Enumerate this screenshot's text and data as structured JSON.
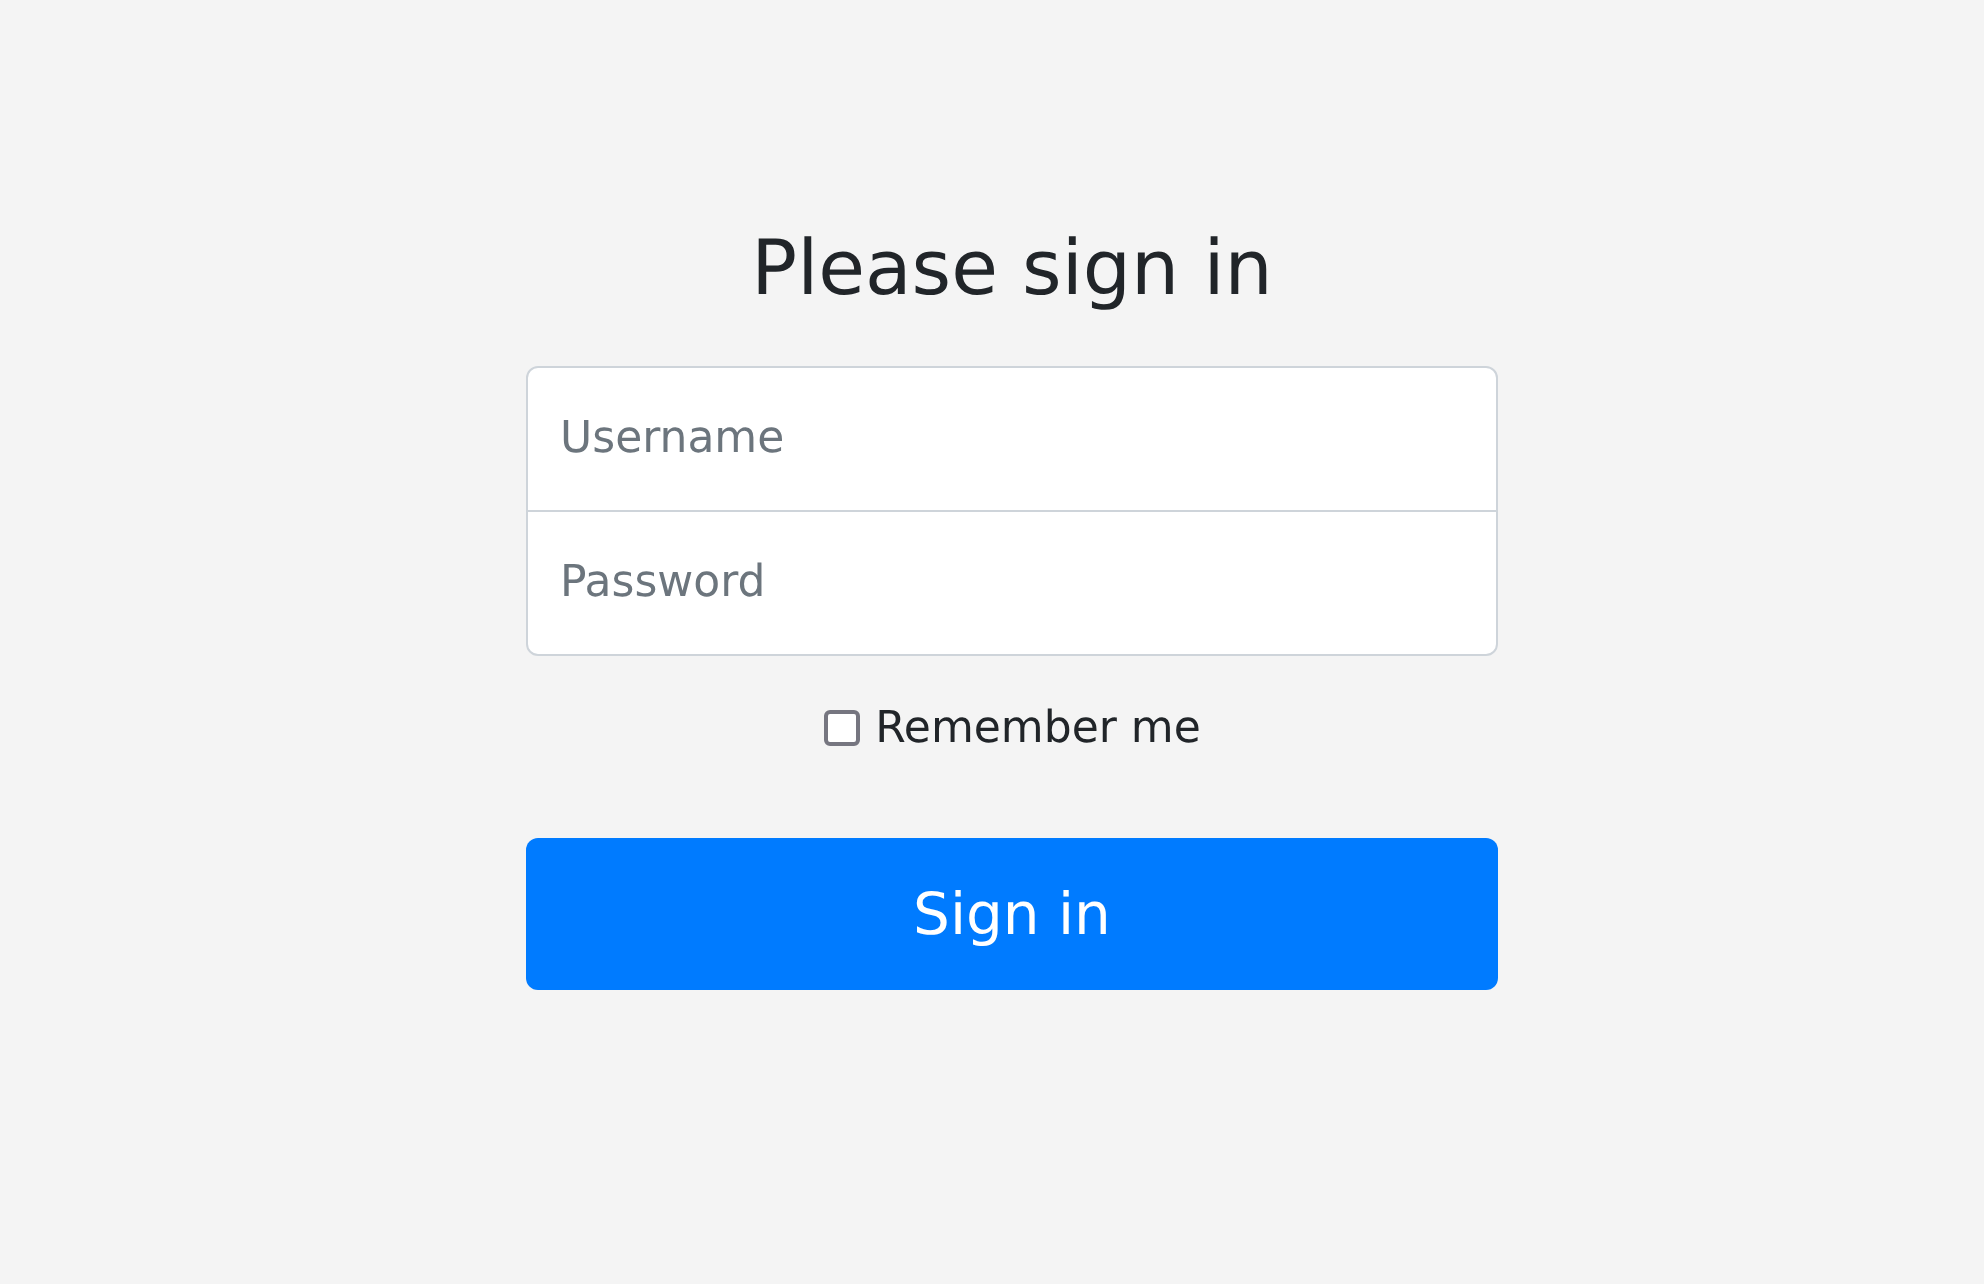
{
  "heading": "Please sign in",
  "fields": [
    {
      "placeholder": "Username"
    },
    {
      "placeholder": "Password"
    }
  ],
  "remember": {
    "label": "Remember me",
    "checked": false
  },
  "button": {
    "label": "Sign in"
  }
}
